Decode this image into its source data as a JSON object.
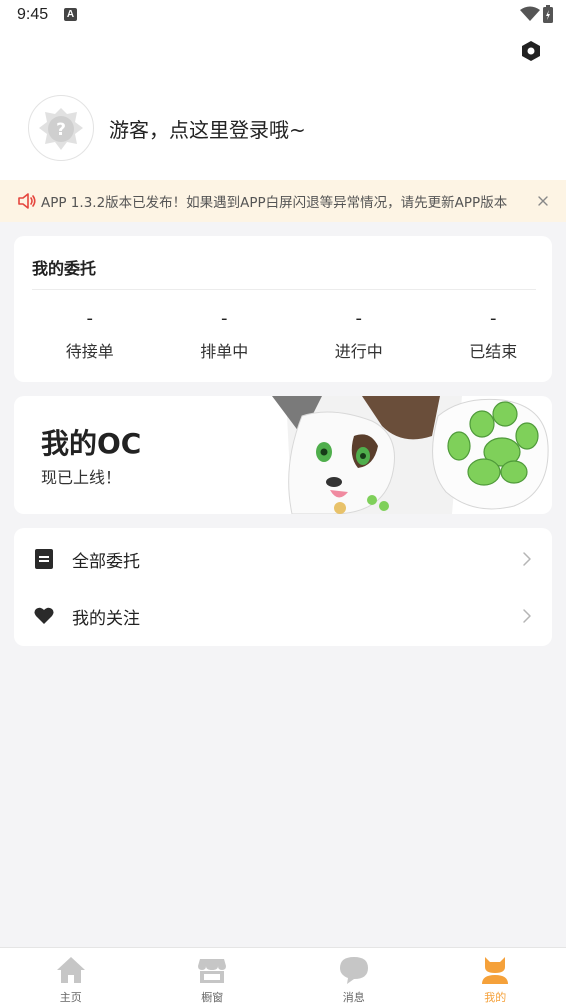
{
  "status_bar": {
    "time": "9:45",
    "notification_letter": "A"
  },
  "profile": {
    "login_prompt": "游客，点这里登录哦~",
    "avatar_icon": "question-avatar-icon"
  },
  "notice": {
    "text": "APP 1.3.2版本已发布！如果遇到APP白屏闪退等异常情况，请先更新APP版本"
  },
  "commissions": {
    "title": "我的委托",
    "stats": [
      {
        "value": "-",
        "label": "待接单"
      },
      {
        "value": "-",
        "label": "排单中"
      },
      {
        "value": "-",
        "label": "进行中"
      },
      {
        "value": "-",
        "label": "已结束"
      }
    ]
  },
  "oc_banner": {
    "title": "我的OC",
    "subtitle": "现已上线！"
  },
  "menu": [
    {
      "label": "全部委托",
      "icon": "document-icon"
    },
    {
      "label": "我的关注",
      "icon": "heart-icon"
    }
  ],
  "tabbar": [
    {
      "label": "主页",
      "icon": "home-icon",
      "active": false
    },
    {
      "label": "橱窗",
      "icon": "storefront-icon",
      "active": false
    },
    {
      "label": "消息",
      "icon": "chat-bubble-icon",
      "active": false
    },
    {
      "label": "我的",
      "icon": "user-icon",
      "active": true
    }
  ],
  "colors": {
    "accent": "#f5a13a",
    "notice_bg": "#fdf4e4",
    "notice_icon": "#e5463e",
    "page_bg": "#f4f4f6",
    "tab_inactive": "#c6c6c6",
    "paw_green": "#7fd05a"
  }
}
